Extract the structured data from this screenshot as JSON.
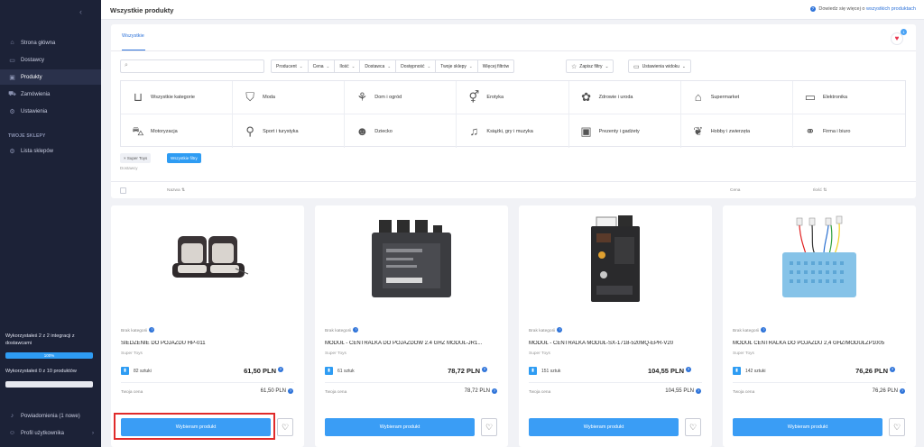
{
  "sidebar": {
    "items": [
      {
        "label": "Strona główna",
        "icon": "home-icon",
        "glyph": "⌂"
      },
      {
        "label": "Dostawcy",
        "icon": "truck-icon",
        "glyph": "▭"
      },
      {
        "label": "Produkty",
        "icon": "box-icon",
        "glyph": "▣"
      },
      {
        "label": "Zamówienia",
        "icon": "cart-icon",
        "glyph": "⛟"
      },
      {
        "label": "Ustawienia",
        "icon": "gear-icon",
        "glyph": "⚙"
      }
    ],
    "section_title": "TWOJE SKLEPY",
    "store_item": {
      "label": "Lista sklepów",
      "icon": "store-icon",
      "glyph": "⚙"
    },
    "usage_integrations": "Wykorzystałeś 2 z 2 integracji z dostawcami",
    "usage_integrations_pct": "100%",
    "usage_integrations_fraction": 1.0,
    "usage_products": "Wykorzystałeś 0 z 10 produktów",
    "usage_products_pct": "",
    "usage_products_fraction": 0,
    "bottom_items": [
      {
        "label": "Powiadomienia (1 nowe)",
        "icon": "bell-icon",
        "glyph": "🔔"
      },
      {
        "label": "Profil użytkownika",
        "icon": "user-icon",
        "glyph": "☺"
      }
    ]
  },
  "header": {
    "title": "Wszystkie produkty",
    "help_text": "Dowiedz się więcej o",
    "help_link": "wszystkich produktach"
  },
  "tabs": {
    "all": "Wszystkie"
  },
  "favorites_count": "1",
  "search": {
    "placeholder": "",
    "value": ""
  },
  "filters": [
    "Producent",
    "Cena",
    "Ilość",
    "Dostawca",
    "Dostępność",
    "Twoje sklepy",
    "Więcej filtrów"
  ],
  "save_filters_label": "Zapisz filtry",
  "view_settings_label": "Ustawienia widoku",
  "categories": [
    {
      "label": "Wszystkie kategorie",
      "icon": "basket-icon",
      "glyph": "🧺"
    },
    {
      "label": "Moda",
      "icon": "bag-icon",
      "glyph": "👜"
    },
    {
      "label": "Dom i ogród",
      "icon": "garden-icon",
      "glyph": "🪴"
    },
    {
      "label": "Erotyka",
      "icon": "gender-icon",
      "glyph": "⚥"
    },
    {
      "label": "Zdrowie i uroda",
      "icon": "lotus-icon",
      "glyph": "✿"
    },
    {
      "label": "Supermarket",
      "icon": "supermarket-icon",
      "glyph": "🏪"
    },
    {
      "label": "Elektronika",
      "icon": "electronics-icon",
      "glyph": "🖥"
    },
    {
      "label": "Motoryzacja",
      "icon": "car-icon",
      "glyph": "🚗"
    },
    {
      "label": "Sport i turystyka",
      "icon": "bike-icon",
      "glyph": "🚲"
    },
    {
      "label": "Dziecko",
      "icon": "bear-icon",
      "glyph": "🧸"
    },
    {
      "label": "Książki, gry i muzyka",
      "icon": "guitar-icon",
      "glyph": "🎸"
    },
    {
      "label": "Prezenty i gadżety",
      "icon": "gift-icon",
      "glyph": "🎁"
    },
    {
      "label": "Hobby i zwierzęta",
      "icon": "butterfly-icon",
      "glyph": "🦋"
    },
    {
      "label": "Firma i biuro",
      "icon": "handshake-icon",
      "glyph": "🤝"
    }
  ],
  "active_chips": {
    "store": "× Super Toys",
    "all_filters": "Wszystkie filtry"
  },
  "chips_hint": "Dostawcy",
  "table_headers": {
    "name": "Nazwa ⇅",
    "price": "Cena",
    "qty": "Ilość ⇅"
  },
  "products": [
    {
      "category": "Brak kategorii",
      "name": "SIEDZENIE DO POJAZDU HP-011",
      "store": "Super Toys",
      "stock": "82 sztuki",
      "price": "61,50 PLN",
      "your_price_label": "Twoja cena",
      "your_price": "61,50 PLN",
      "button": "Wybieram produkt"
    },
    {
      "category": "Brak kategorii",
      "name": "MODUŁ - CENTRALKA DO POJAZDÓW 2.4 GHZ MODUŁ-JR1...",
      "store": "Super Toys",
      "stock": "61 sztuk",
      "price": "78,72 PLN",
      "your_price_label": "Twoja cena",
      "your_price": "78,72 PLN",
      "button": "Wybieram produkt"
    },
    {
      "category": "Brak kategorii",
      "name": "MODUŁ - CENTRALKA MODUŁ-SX-1718-520MQ-EPR-V20",
      "store": "Super Toys",
      "stock": "151 sztuk",
      "price": "104,55 PLN",
      "your_price_label": "Twoja cena",
      "your_price": "104,55 PLN",
      "button": "Wybieram produkt"
    },
    {
      "category": "Brak kategorii",
      "name": "MODUŁ CENTRALKA DO POJAZDU 2,4 GHZ/MODUŁZP1005",
      "store": "Super Toys",
      "stock": "142 sztuki",
      "price": "76,26 PLN",
      "your_price_label": "Twoja cena",
      "your_price": "76,26 PLN",
      "button": "Wybieram produkt"
    }
  ],
  "colors": {
    "sidebar_bg": "#1c2237",
    "accent": "#3a9df5",
    "highlight": "#e02a2a",
    "favorite": "#e8304b"
  }
}
